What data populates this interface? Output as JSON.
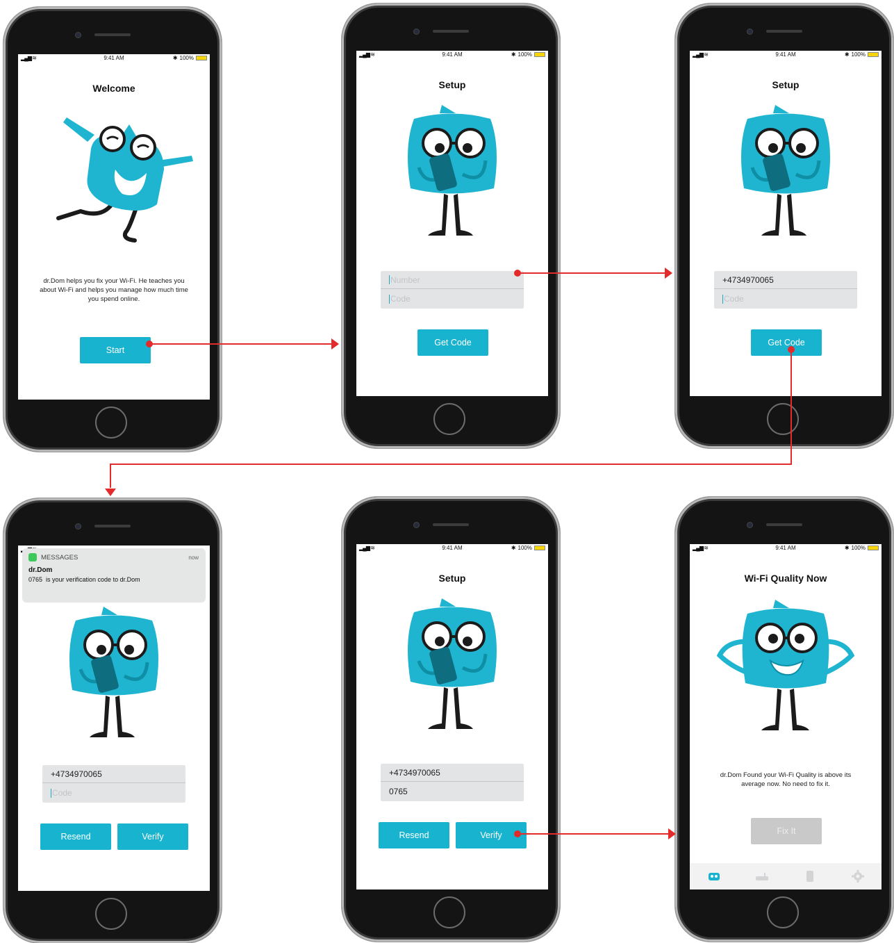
{
  "status_bar": {
    "time": "9:41 AM",
    "battery": "100%"
  },
  "screens": {
    "welcome": {
      "title": "Welcome",
      "description": "dr.Dom helps you fix your Wi-Fi. He teaches you about Wi-Fi and helps you manage how much time you spend online.",
      "start_label": "Start"
    },
    "setup_empty": {
      "title": "Setup",
      "number_placeholder": "Number",
      "code_placeholder": "Code",
      "get_code_label": "Get Code"
    },
    "setup_number": {
      "title": "Setup",
      "number_value": "+4734970065",
      "code_placeholder": "Code",
      "get_code_label": "Get Code"
    },
    "setup_message": {
      "notification": {
        "app": "MESSAGES",
        "time": "now",
        "sender": "dr.Dom",
        "message": "0765  is your verification code to dr.Dom"
      },
      "number_value": "+4734970065",
      "code_placeholder": "Code",
      "resend_label": "Resend",
      "verify_label": "Verify"
    },
    "setup_code": {
      "title": "Setup",
      "number_value": "+4734970065",
      "code_value": "0765",
      "resend_label": "Resend",
      "verify_label": "Verify"
    },
    "quality": {
      "title": "Wi-Fi Quality Now",
      "description": "dr.Dom Found your Wi-Fi Quality is above its average now. No need to fix it.",
      "fix_label": "Fix It",
      "tabs": [
        "mascot-icon",
        "router-icon",
        "phone-icon",
        "gear-icon"
      ]
    }
  },
  "colors": {
    "accent": "#18b4cf",
    "arrow": "#e32b2b",
    "mascot_body": "#1fb5d1",
    "disabled": "#c9c9c9"
  }
}
